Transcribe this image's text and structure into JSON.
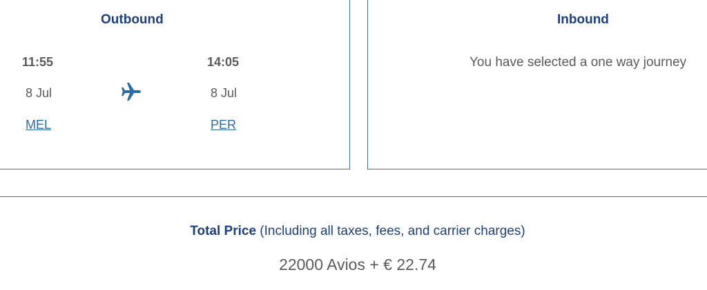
{
  "outbound": {
    "title": "Outbound",
    "departure": {
      "time": "11:55",
      "date": "8 Jul",
      "airport": "MEL"
    },
    "arrival": {
      "time": "14:05",
      "date": "8 Jul",
      "airport": "PER"
    },
    "icon": "airplane-icon"
  },
  "inbound": {
    "title": "Inbound",
    "message": "You have selected a one way journey"
  },
  "total": {
    "label": "Total Price",
    "note": "(Including all taxes, fees, and carrier charges)",
    "price": "22000 Avios + € 22.74"
  },
  "colors": {
    "heading": "#1d3f7c",
    "link": "#2b6aa8",
    "border": "#4a6fa5",
    "text": "#5a5a5a"
  }
}
